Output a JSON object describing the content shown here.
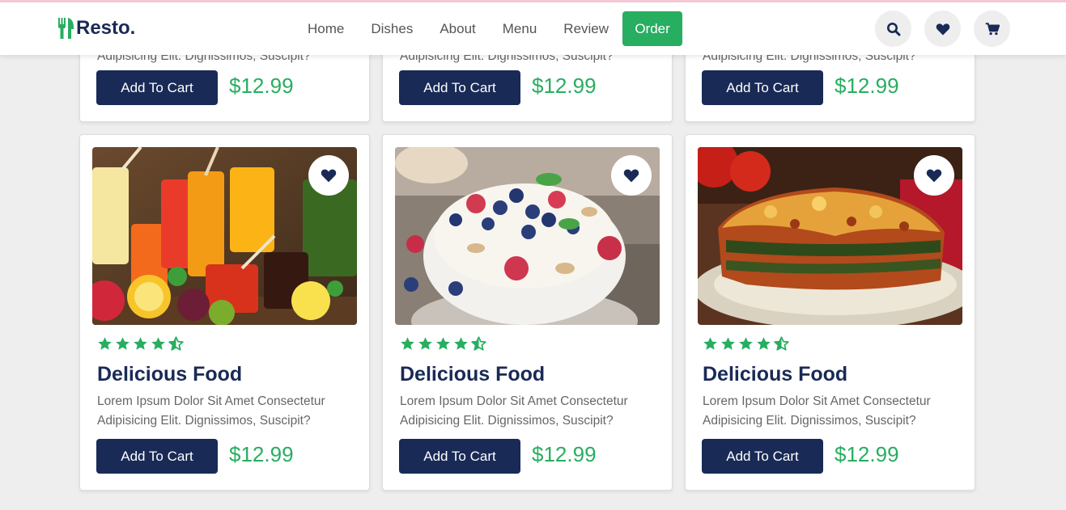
{
  "brand": {
    "name": "Resto."
  },
  "nav": {
    "home": "Home",
    "dishes": "Dishes",
    "about": "About",
    "menu": "Menu",
    "review": "Review",
    "order": "Order"
  },
  "colors": {
    "primary": "#192a56",
    "accent": "#27ae60"
  },
  "icons": {
    "search": "search-icon",
    "heart": "heart-icon",
    "cart": "cart-icon",
    "star": "star-icon",
    "star_half": "star-half-icon"
  },
  "top_cards": [
    {
      "desc": "Adipisicing Elit. Dignissimos, Suscipit?",
      "button": "Add To Cart",
      "price": "$12.99"
    },
    {
      "desc": "Adipisicing Elit. Dignissimos, Suscipit?",
      "button": "Add To Cart",
      "price": "$12.99"
    },
    {
      "desc": "Adipisicing Elit. Dignissimos, Suscipit?",
      "button": "Add To Cart",
      "price": "$12.99"
    }
  ],
  "cards": [
    {
      "image": "colorful juices",
      "rating": 4.5,
      "title": "Delicious Food",
      "desc": "Lorem Ipsum Dolor Sit Amet Consectetur Adipisicing Elit. Dignissimos, Suscipit?",
      "button": "Add To Cart",
      "price": "$12.99"
    },
    {
      "image": "berry yogurt bowl",
      "rating": 4.5,
      "title": "Delicious Food",
      "desc": "Lorem Ipsum Dolor Sit Amet Consectetur Adipisicing Elit. Dignissimos, Suscipit?",
      "button": "Add To Cart",
      "price": "$12.99"
    },
    {
      "image": "lasagna",
      "rating": 4.5,
      "title": "Delicious Food",
      "desc": "Lorem Ipsum Dolor Sit Amet Consectetur Adipisicing Elit. Dignissimos, Suscipit?",
      "button": "Add To Cart",
      "price": "$12.99"
    }
  ]
}
